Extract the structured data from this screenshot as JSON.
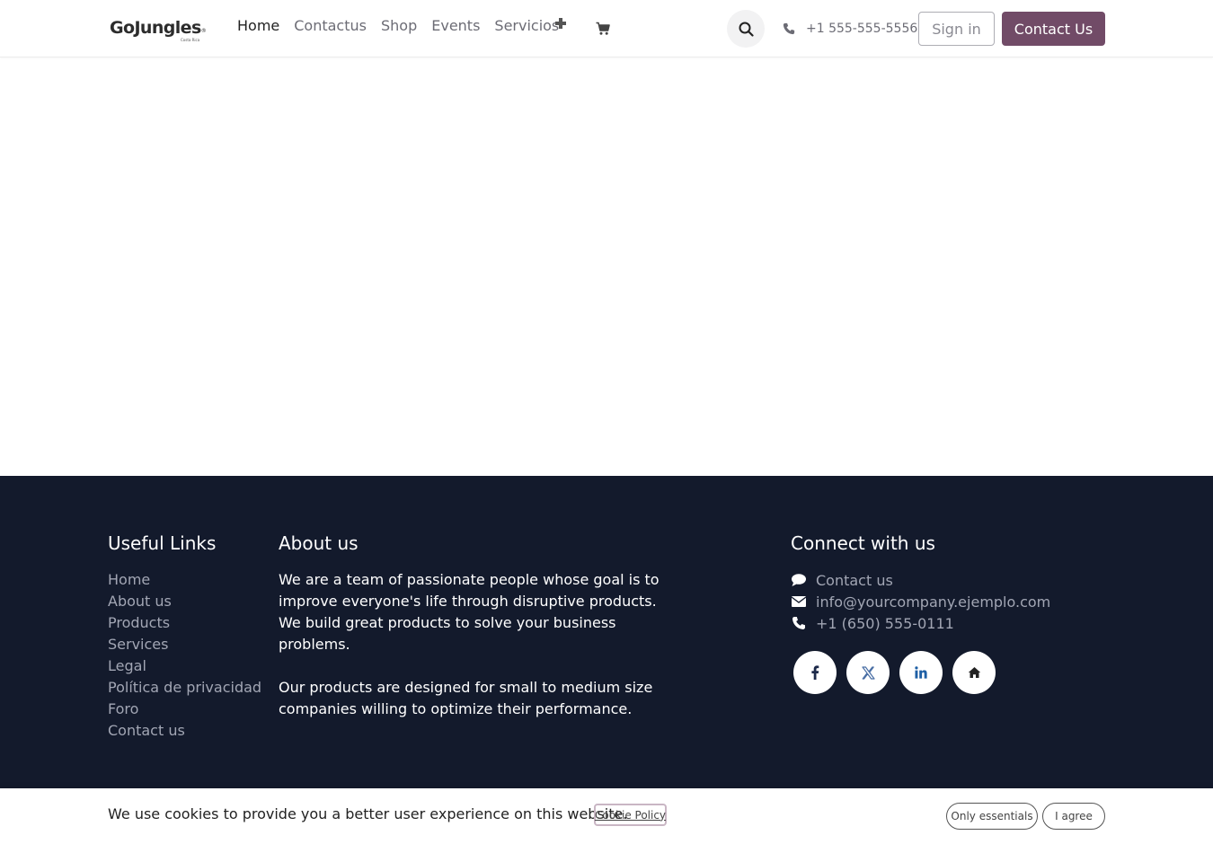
{
  "header": {
    "logo": {
      "main": "GoJungles",
      "mark": "®",
      "sub": "Costa Rica"
    },
    "nav": [
      "Home",
      "Contactus",
      "Shop",
      "Events",
      "Servicios"
    ],
    "phone": "+1 555-555-5556",
    "signin_label": "Sign in",
    "contact_label": "Contact Us",
    "icons": {
      "add": "plus-icon",
      "cart": "cart-icon",
      "search": "search-icon",
      "phone": "phone-icon"
    }
  },
  "footer": {
    "useful_links_title": "Useful Links",
    "links": [
      "Home",
      "About us",
      "Products",
      "Services",
      "Legal",
      "Política de privacidad",
      "Foro",
      "Contact us"
    ],
    "about_title": "About us",
    "about_p1": "We are a team of passionate people whose goal is to improve everyone's life through disruptive products. We build great products to solve your business problems.",
    "about_p2": "Our products are designed for small to medium size companies willing to optimize their performance.",
    "connect_title": "Connect with us",
    "connect": {
      "contact": "Contact us",
      "email": "info@yourcompany.ejemplo.com",
      "phone": "+1 (650) 555-0111"
    },
    "socials": [
      "facebook-icon",
      "x-icon",
      "linkedin-icon",
      "home-icon"
    ]
  },
  "cookie": {
    "text": "We use cookies to provide you a better user experience on this website.",
    "policy_link": "Cookie Policy",
    "essentials_label": "Only essentials",
    "agree_label": "I agree"
  },
  "colors": {
    "brand": "#714b67",
    "footer_bg": "#131a2c",
    "muted_text": "#a2a6b4"
  }
}
